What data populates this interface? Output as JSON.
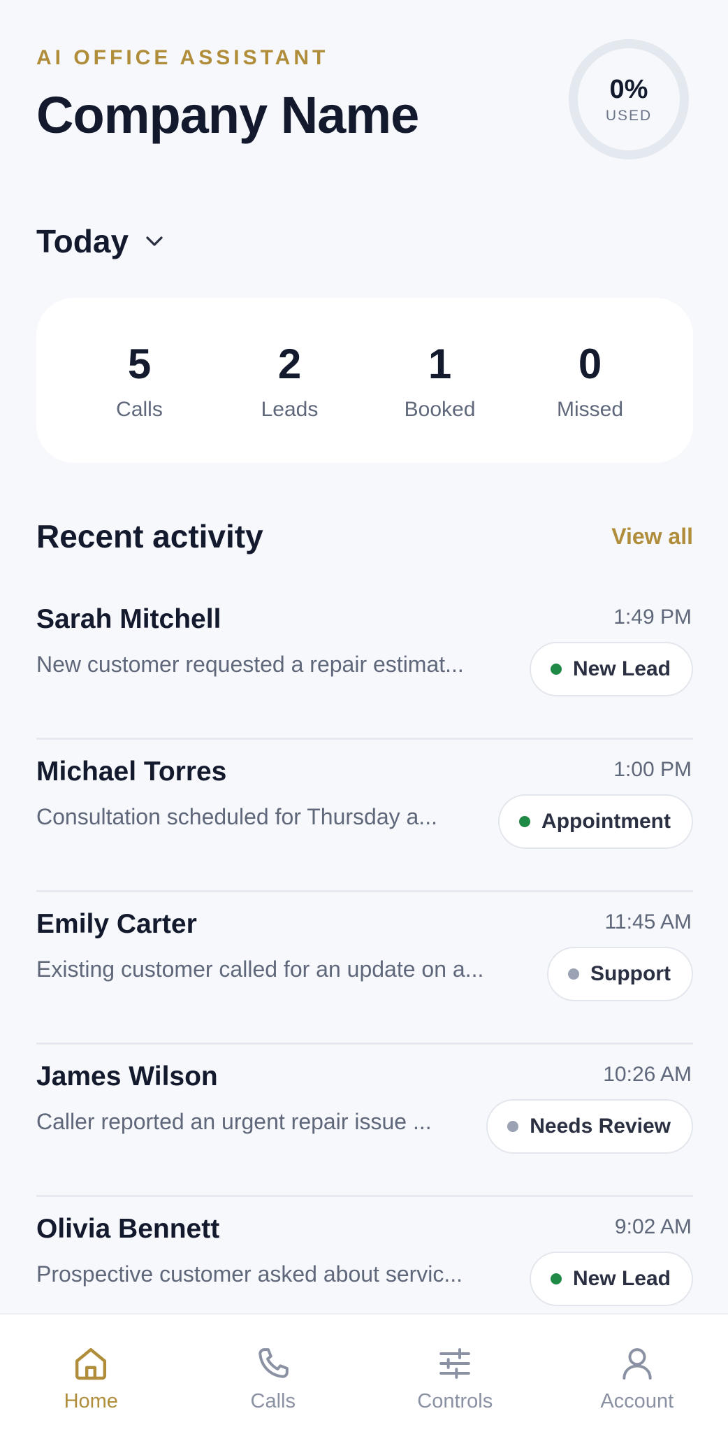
{
  "header": {
    "eyebrow": "AI OFFICE ASSISTANT",
    "company": "Company Name",
    "usage_percent": "0%",
    "usage_label": "USED"
  },
  "period": {
    "label": "Today"
  },
  "stats": [
    {
      "value": "5",
      "label": "Calls"
    },
    {
      "value": "2",
      "label": "Leads"
    },
    {
      "value": "1",
      "label": "Booked"
    },
    {
      "value": "0",
      "label": "Missed"
    }
  ],
  "recent": {
    "title": "Recent activity",
    "view_all": "View all",
    "items": [
      {
        "name": "Sarah Mitchell",
        "time": "1:49 PM",
        "desc": "New customer requested a repair estimat...",
        "tag": "New Lead",
        "tag_color": "#1f8a45"
      },
      {
        "name": "Michael Torres",
        "time": "1:00 PM",
        "desc": "Consultation scheduled for Thursday a...",
        "tag": "Appointment",
        "tag_color": "#1f8a45"
      },
      {
        "name": "Emily Carter",
        "time": "11:45 AM",
        "desc": "Existing customer called for an update on a...",
        "tag": "Support",
        "tag_color": "#9aa2b4"
      },
      {
        "name": "James Wilson",
        "time": "10:26 AM",
        "desc": "Caller reported an urgent repair issue ...",
        "tag": "Needs Review",
        "tag_color": "#9aa2b4"
      },
      {
        "name": "Olivia Bennett",
        "time": "9:02 AM",
        "desc": "Prospective customer asked about servic...",
        "tag": "New Lead",
        "tag_color": "#1f8a45"
      }
    ]
  },
  "tabs": [
    {
      "label": "Home",
      "icon": "home-icon",
      "active": true
    },
    {
      "label": "Calls",
      "icon": "phone-icon",
      "active": false
    },
    {
      "label": "Controls",
      "icon": "sliders-icon",
      "active": false
    },
    {
      "label": "Account",
      "icon": "user-icon",
      "active": false
    }
  ],
  "colors": {
    "accent": "#b08d3a",
    "text": "#141a2e",
    "muted": "#5f677a",
    "background": "#f7f8fb"
  }
}
